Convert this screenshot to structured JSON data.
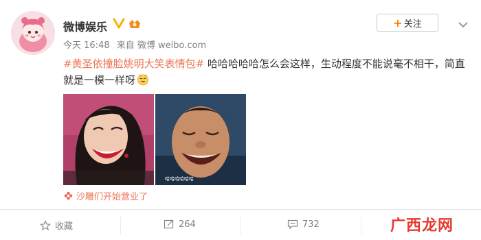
{
  "author": {
    "name": "微博娱乐"
  },
  "post": {
    "time": "今天 16:48",
    "source": "来自 微博 weibo.com",
    "topic": "#黄圣依撞脸姚明大笑表情包#",
    "text": " 哈哈哈哈哈怎么会这样，生动程度不能说毫不相干，简直就是一模一样呀",
    "image_caption": "哈哈哈哈哈哈"
  },
  "follow_button": {
    "label": "关注"
  },
  "super_topic": {
    "label": "沙雕们开始营业了"
  },
  "actions": {
    "favorite": "收藏",
    "repost": "264",
    "comment": "732"
  },
  "watermark": {
    "text": "广西龙网"
  },
  "colors": {
    "accent": "#ff8200",
    "topic": "#eb7350",
    "muted": "#808080",
    "verified": "#f5b400",
    "watermark": "#e8382f"
  },
  "icons": [
    "avatar",
    "verified-icon",
    "level-icon",
    "chevron-down-icon",
    "laugh-emoji-icon",
    "flower-icon",
    "star-icon",
    "repost-icon",
    "comment-icon"
  ]
}
